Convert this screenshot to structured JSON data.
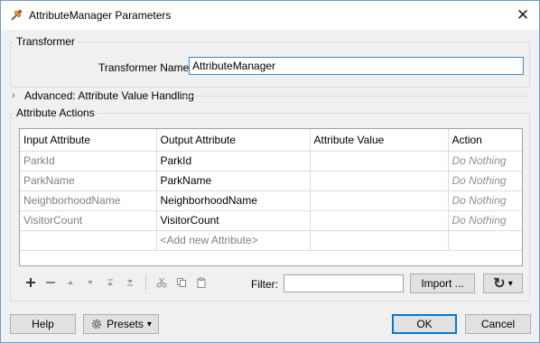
{
  "window": {
    "title": "AttributeManager Parameters",
    "close_glyph": "✕"
  },
  "transformer": {
    "group_label": "Transformer",
    "name_label": "Transformer Name:",
    "name_value": "AttributeManager"
  },
  "advanced": {
    "label": "Advanced: Attribute Value Handling",
    "chevron": "›"
  },
  "attribute_actions": {
    "group_label": "Attribute Actions",
    "columns": [
      "Input Attribute",
      "Output Attribute",
      "Attribute Value",
      "Action"
    ],
    "rows": [
      {
        "input": "ParkId",
        "output": "ParkId",
        "value": "",
        "action": "Do Nothing"
      },
      {
        "input": "ParkName",
        "output": "ParkName",
        "value": "",
        "action": "Do Nothing"
      },
      {
        "input": "NeighborhoodName",
        "output": "NeighborhoodName",
        "value": "",
        "action": "Do Nothing"
      },
      {
        "input": "VisitorCount",
        "output": "VisitorCount",
        "value": "",
        "action": "Do Nothing"
      }
    ],
    "add_new_placeholder": "<Add new Attribute>"
  },
  "toolbar": {
    "icons": [
      "plus-icon",
      "minus-icon",
      "move-up-icon",
      "move-down-icon",
      "move-top-icon",
      "move-bottom-icon",
      "cut-icon",
      "copy-icon",
      "paste-icon"
    ],
    "filter_label": "Filter:",
    "filter_value": "",
    "import_label": "Import ...",
    "reset_glyph": "↻",
    "dropdown_glyph": "▾"
  },
  "footer": {
    "help_label": "Help",
    "presets_label": "Presets",
    "presets_arrow": "▾",
    "ok_label": "OK",
    "cancel_label": "Cancel"
  },
  "colors": {
    "accent": "#0078d7",
    "input_focus": "#3b87d4",
    "muted_text": "#808080"
  }
}
